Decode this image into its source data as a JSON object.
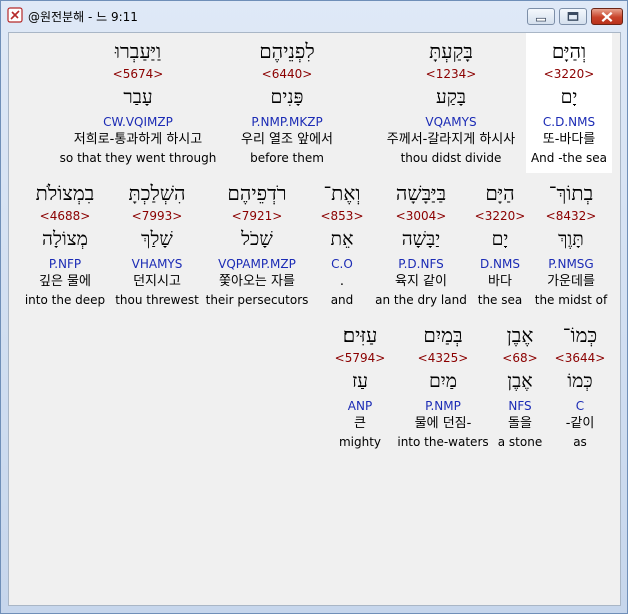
{
  "window": {
    "title": "@원전분해 - 느 9:11"
  },
  "rows": [
    [
      {
        "hebrew": "וְהַיָּם",
        "number": "<3220>",
        "lexeme": "יָם",
        "parse": "C.D.NMS",
        "korean": "또-바다를",
        "english": "And -the sea",
        "highlighted": true
      },
      {
        "hebrew": "בָּקַעְתָּ",
        "number": "<1234>",
        "lexeme": "בָּקַע",
        "parse": "VQAMYS",
        "korean": "주께서-갈라지게 하시사",
        "english": "thou didst divide"
      },
      {
        "hebrew": "לִפְנֵיהֶם",
        "number": "<6440>",
        "lexeme": "פָּנִים",
        "parse": "P.NMP.MKZP",
        "korean": "우리 열조 앞에서",
        "english": "before them"
      },
      {
        "hebrew": "וַיַּעַבְרוּ",
        "number": "<5674>",
        "lexeme": "עָבַר",
        "parse": "CW.VQIMZP",
        "korean": "저희로-통과하게 하시고",
        "english": "so that they went through"
      }
    ],
    [
      {
        "hebrew": "בְתוֹךְ־",
        "number": "<8432>",
        "lexeme": "תָּוֶךְ",
        "parse": "P.NMSG",
        "korean": "가운데를",
        "english": "the midst of"
      },
      {
        "hebrew": "הַיָּם",
        "number": "<3220>",
        "lexeme": "יָם",
        "parse": "D.NMS",
        "korean": "바다",
        "english": "the sea"
      },
      {
        "hebrew": "בַּיַּבָּשָׁה",
        "number": "<3004>",
        "lexeme": "יַבָּשָׁה",
        "parse": "P.D.NFS",
        "korean": "육지 같이",
        "english": "an the dry land"
      },
      {
        "hebrew": "וְאֶת־",
        "number": "<853>",
        "lexeme": "אֵת",
        "parse": "C.O",
        "korean": ".",
        "english": "and"
      },
      {
        "hebrew": "רֹדְפֵיהֶם",
        "number": "<7921>",
        "lexeme": "שָׁכֹל",
        "parse": "VQPAMP.MZP",
        "korean": "쫓아오는 자를",
        "english": "their persecutors"
      },
      {
        "hebrew": "הִשְׁלַכְתָּ",
        "number": "<7993>",
        "lexeme": "שָׁלַךְ",
        "parse": "VHAMYS",
        "korean": "던지시고",
        "english": "thou threwest"
      },
      {
        "hebrew": "בִמְצוֹלֹת",
        "number": "<4688>",
        "lexeme": "מְצוֹלָה",
        "parse": "P.NFP",
        "korean": "깊은 물에",
        "english": "into the deep"
      }
    ],
    [
      {
        "hebrew": "כְּמוֹ־",
        "number": "<3644>",
        "lexeme": "כְּמוֹ",
        "parse": "C",
        "korean": "-같이",
        "english": "as"
      },
      {
        "hebrew": "אֶבֶן",
        "number": "<68>",
        "lexeme": "אֶבֶן",
        "parse": "NFS",
        "korean": "돌을",
        "english": "a stone"
      },
      {
        "hebrew": "בְּמַיִם",
        "number": "<4325>",
        "lexeme": "מַיִם",
        "parse": "P.NMP",
        "korean": "물에 던짐-",
        "english": "into the-waters"
      },
      {
        "hebrew": "עַזִּים׃",
        "number": "<5794>",
        "lexeme": "עַז",
        "parse": "ANP",
        "korean": "큰",
        "english": "mighty"
      }
    ]
  ]
}
